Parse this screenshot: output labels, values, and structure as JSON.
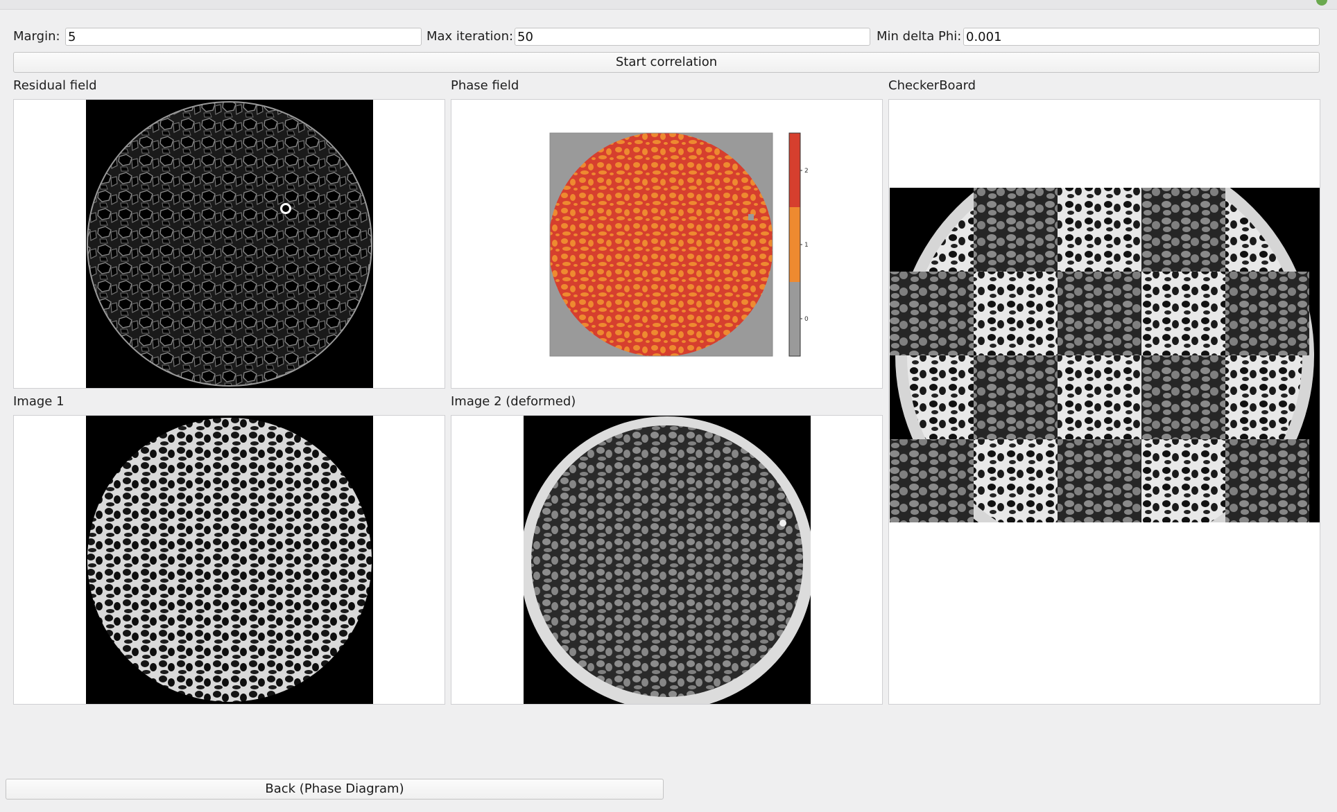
{
  "params": {
    "margin_label": "Margin:",
    "margin_value": "5",
    "max_iter_label": "Max iteration:",
    "max_iter_value": "50",
    "min_delta_label": "Min delta Phi:",
    "min_delta_value": "0.001"
  },
  "actions": {
    "start_label": "Start correlation",
    "back_label": "Back (Phase Diagram)"
  },
  "panels": {
    "residual_title": "Residual field",
    "phase_title": "Phase field",
    "checker_title": "CheckerBoard",
    "image1_title": "Image 1",
    "image2_title": "Image 2 (deformed)"
  },
  "colorbar": {
    "ticks": [
      "2",
      "1",
      "0"
    ],
    "colors": [
      "#d63f2e",
      "#ee8a30",
      "#9a9a9a"
    ]
  }
}
